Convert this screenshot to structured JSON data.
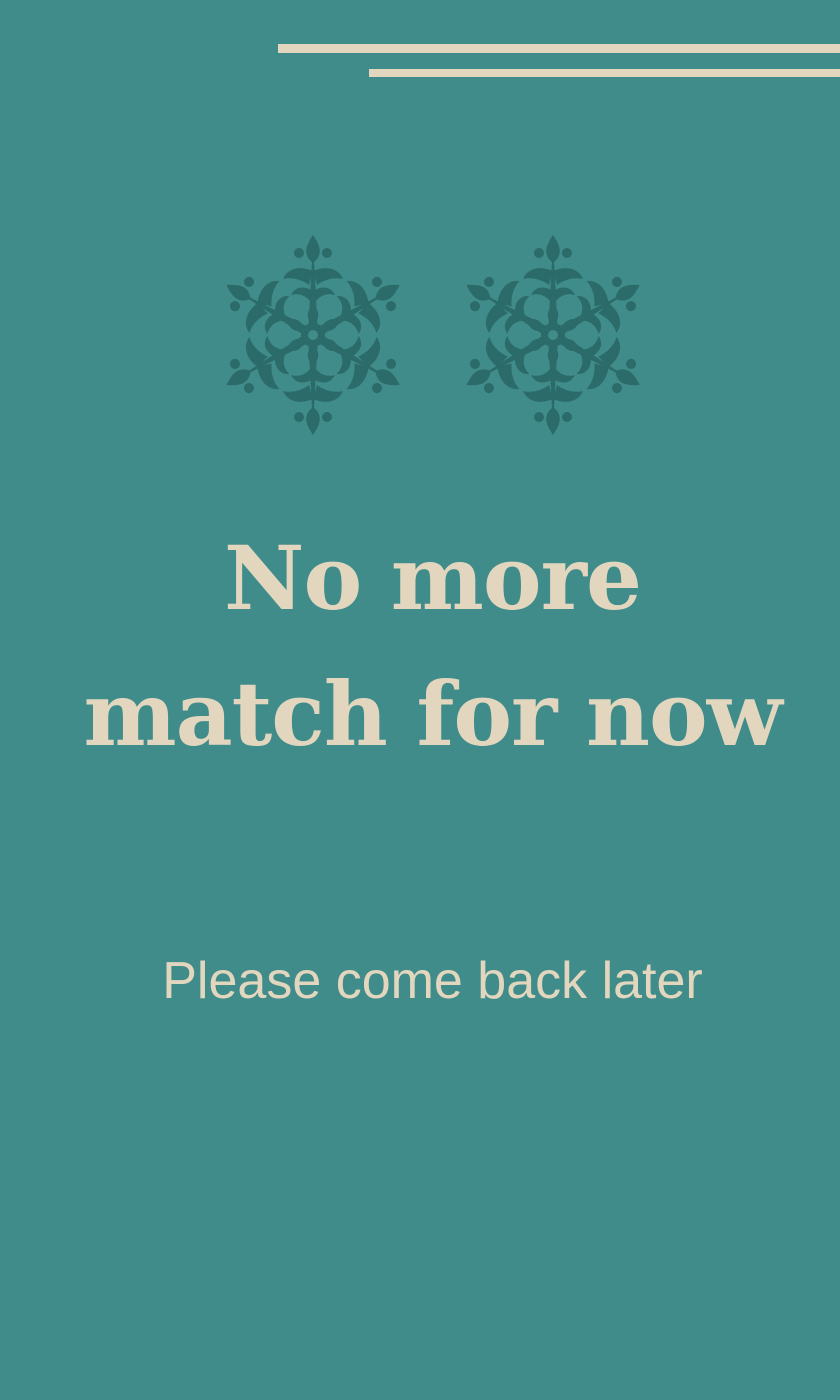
{
  "empty_state": {
    "title": "No more match for now",
    "message": "Please come back later"
  },
  "colors": {
    "background": "#408C8A",
    "text": "#E2D7BE",
    "ornament": "#2B6B69"
  },
  "icons": [
    "snowflake-ornament-icon",
    "snowflake-ornament-icon"
  ]
}
